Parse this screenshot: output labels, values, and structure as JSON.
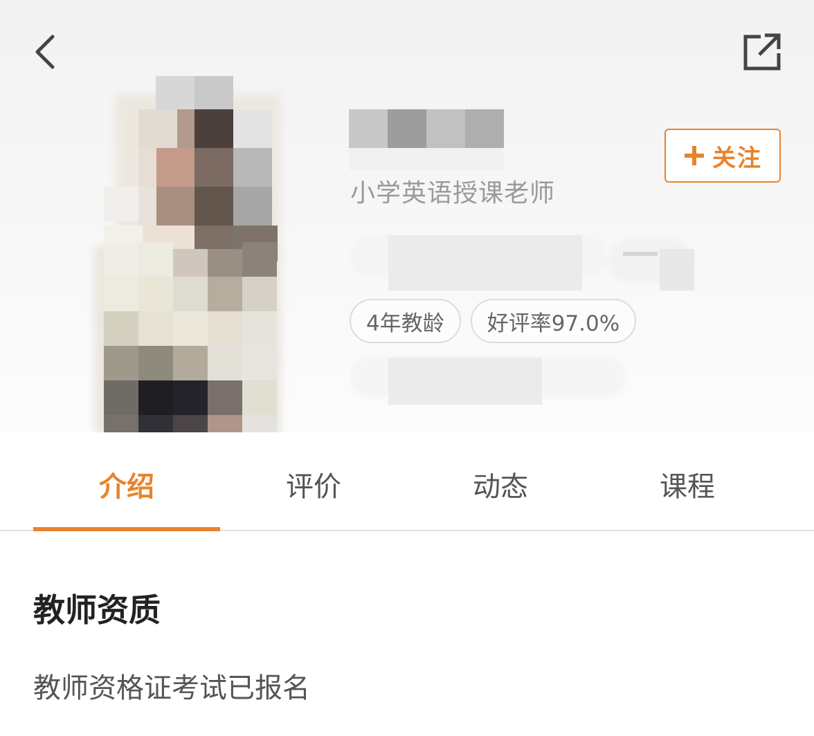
{
  "header": {
    "back_icon": "chevron-left-icon",
    "share_icon": "share-external-icon"
  },
  "profile": {
    "subtitle": "小学英语授课老师",
    "follow_label": "关注",
    "follow_icon": "plus-icon",
    "tags": [
      "4年教龄",
      "好评率97.0%"
    ]
  },
  "tabs": [
    {
      "label": "介绍",
      "active": true
    },
    {
      "label": "评价",
      "active": false
    },
    {
      "label": "动态",
      "active": false
    },
    {
      "label": "课程",
      "active": false
    }
  ],
  "section": {
    "title": "教师资质",
    "text": "教师资格证考试已报名"
  },
  "colors": {
    "accent": "#e8832c",
    "tag_border": "#dcdcdc",
    "subtitle": "#9a9a9a"
  }
}
